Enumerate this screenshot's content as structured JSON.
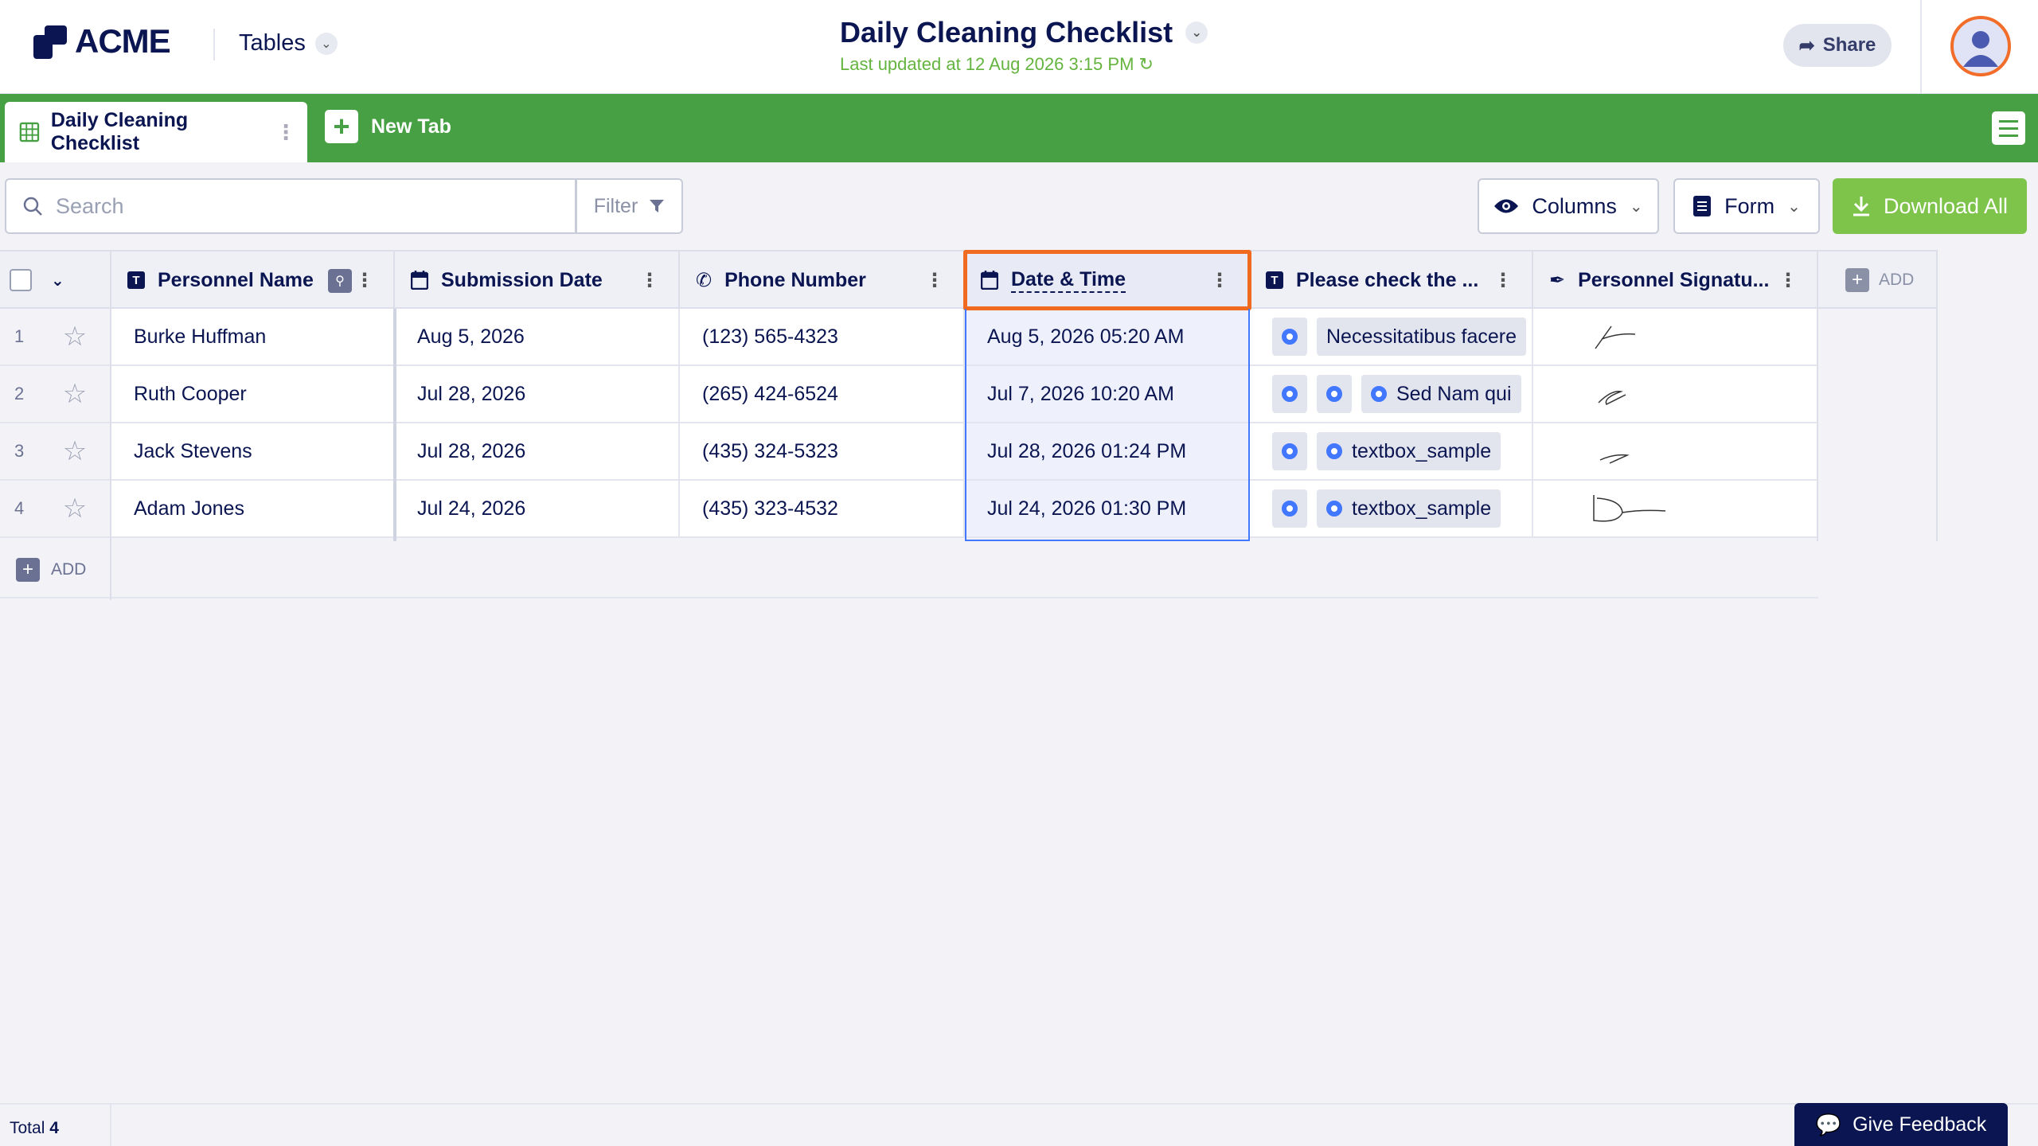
{
  "header": {
    "logo_text": "ACME",
    "tables_label": "Tables",
    "title": "Daily Cleaning Checklist",
    "last_updated": "Last updated at 12 Aug 2026 3:15 PM",
    "share_label": "Share"
  },
  "tabs": {
    "active_label": "Daily Cleaning Checklist",
    "new_tab_label": "New Tab"
  },
  "toolbar": {
    "search_placeholder": "Search",
    "filter_label": "Filter",
    "columns_label": "Columns",
    "form_label": "Form",
    "download_label": "Download All"
  },
  "table": {
    "columns": [
      "Personnel Name",
      "Submission Date",
      "Phone Number",
      "Date & Time",
      "Please check the ...",
      "Personnel Signatu..."
    ],
    "add_column_label": "ADD",
    "add_row_label": "ADD",
    "rows": [
      {
        "index": "1",
        "name": "Burke Huffman",
        "submission": "Aug 5, 2026",
        "phone": "(123) 565-4323",
        "datetime": "Aug 5, 2026 05:20 AM",
        "check_text": "Necessitatibus facere"
      },
      {
        "index": "2",
        "name": "Ruth Cooper",
        "submission": "Jul 28, 2026",
        "phone": "(265) 424-6524",
        "datetime": "Jul 7, 2026 10:20 AM",
        "check_text": "Sed Nam qui"
      },
      {
        "index": "3",
        "name": "Jack Stevens",
        "submission": "Jul 28, 2026",
        "phone": "(435) 324-5323",
        "datetime": "Jul 28, 2026 01:24 PM",
        "check_text": "textbox_sample"
      },
      {
        "index": "4",
        "name": "Adam Jones",
        "submission": "Jul 24, 2026",
        "phone": "(435) 323-4532",
        "datetime": "Jul 24, 2026 01:30 PM",
        "check_text": "textbox_sample"
      }
    ]
  },
  "footer": {
    "total_label": "Total",
    "total_count": "4",
    "feedback_label": "Give Feedback"
  },
  "colors": {
    "brand_green": "#47a043",
    "download_green": "#7ec34a",
    "navy": "#0a1551",
    "highlight_orange": "#f06b1f",
    "updated_green": "#64b43f"
  }
}
